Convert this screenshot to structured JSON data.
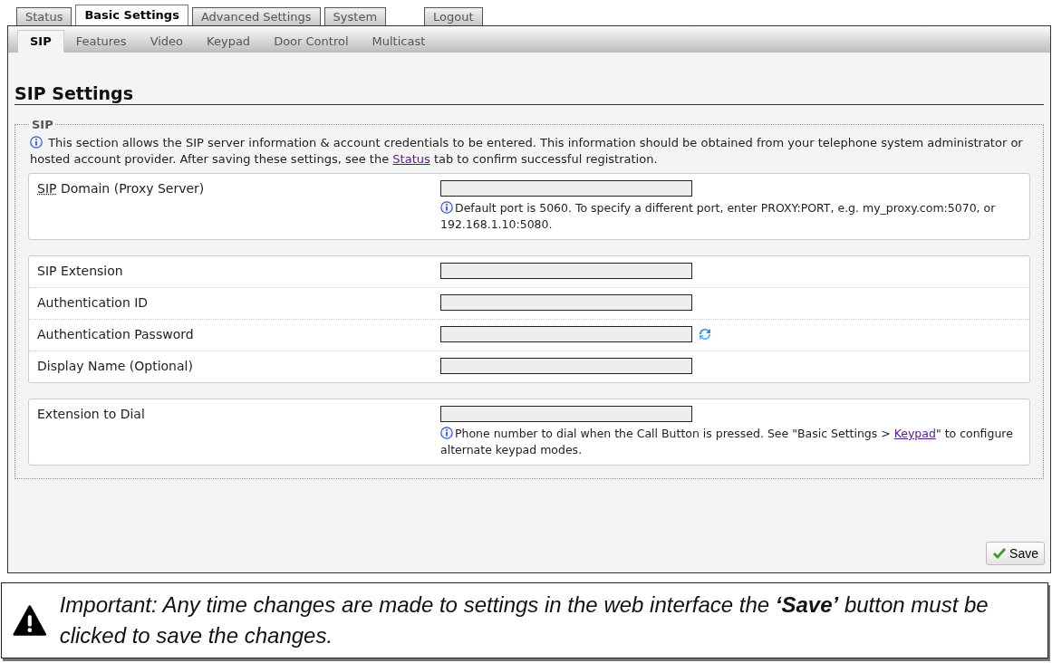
{
  "tabs": [
    {
      "label": "Status",
      "selected": false
    },
    {
      "label": "Basic Settings",
      "selected": true
    },
    {
      "label": "Advanced Settings",
      "selected": false
    },
    {
      "label": "System",
      "selected": false
    },
    {
      "label": "Logout",
      "selected": false,
      "kind": "detached"
    }
  ],
  "subtabs": [
    {
      "label": "SIP",
      "selected": true
    },
    {
      "label": "Features",
      "selected": false
    },
    {
      "label": "Video",
      "selected": false
    },
    {
      "label": "Keypad",
      "selected": false
    },
    {
      "label": "Door Control",
      "selected": false
    },
    {
      "label": "Multicast",
      "selected": false
    }
  ],
  "page_title": "SIP Settings",
  "section": {
    "legend": "SIP",
    "intro": {
      "before": "This section allows the SIP server information & account credentials to be entered. This information should be obtained from your telephone system administrator or hosted account provider. After saving these settings, see the ",
      "link": "Status",
      "after": " tab to confirm successful registration."
    },
    "groups": [
      {
        "rows": [
          {
            "label_abbr": "SIP",
            "label": " Domain (Proxy Server)",
            "hint": {
              "before": "Default port is 5060. To specify a different port, enter PROXY:PORT, e.g. my_proxy.com:5070, or 192.168.1.10:5080."
            }
          }
        ]
      },
      {
        "rows": [
          {
            "label": "SIP Extension"
          },
          {
            "label": "Authentication ID"
          },
          {
            "label": "Authentication Password",
            "refresh": true
          },
          {
            "label": "Display Name (Optional)"
          }
        ]
      },
      {
        "rows": [
          {
            "label": "Extension to Dial",
            "hint": {
              "before": "Phone number to dial when the Call Button is pressed. See \"Basic Settings > ",
              "link": "Keypad",
              "after": "\" to configure alternate keypad modes."
            }
          }
        ]
      }
    ]
  },
  "save_button": "Save",
  "note": "Important: Any time changes are made to settings in the web interface the **‘Save’** button must be clicked to save the changes."
}
